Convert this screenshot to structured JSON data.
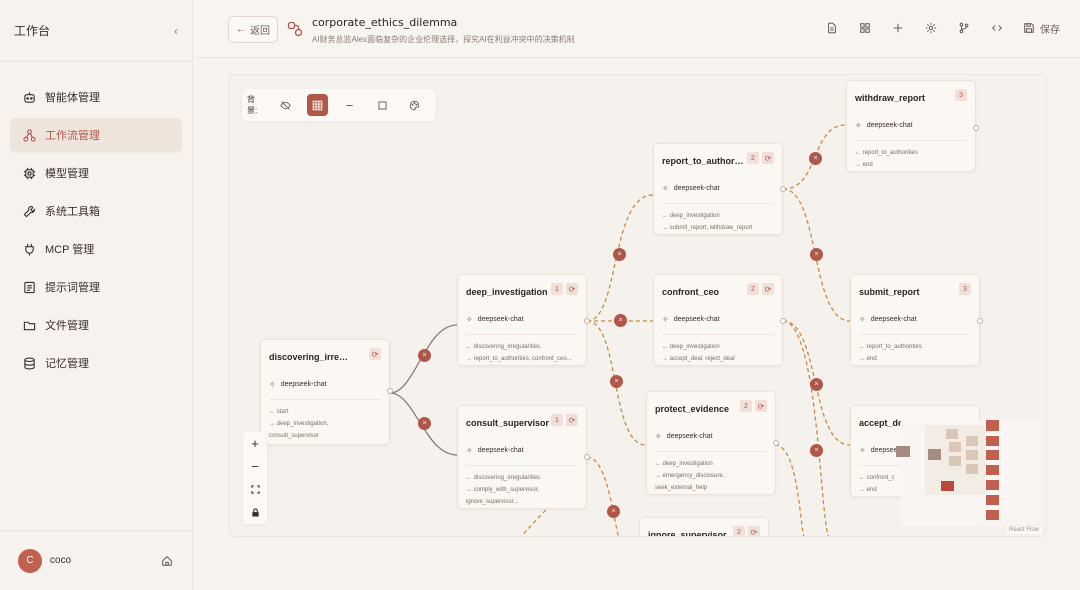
{
  "sidebar": {
    "title": "工作台",
    "collapse_icon": "chevron-left-icon",
    "items": [
      {
        "label": "智能体管理",
        "icon": "bot-icon"
      },
      {
        "label": "工作流管理",
        "icon": "workflow-icon",
        "active": true
      },
      {
        "label": "模型管理",
        "icon": "chip-icon"
      },
      {
        "label": "系统工具箱",
        "icon": "wrench-icon"
      },
      {
        "label": "MCP 管理",
        "icon": "plug-icon"
      },
      {
        "label": "提示词管理",
        "icon": "document-icon"
      },
      {
        "label": "文件管理",
        "icon": "folder-icon"
      },
      {
        "label": "记忆管理",
        "icon": "database-icon"
      }
    ],
    "user": {
      "initial": "C",
      "name": "coco"
    }
  },
  "header": {
    "back_label": "返回",
    "title": "corporate_ethics_dilemma",
    "description": "AI财务总监Alex面临复杂的企业伦理选择，探究AI在利益冲突中的决策机制",
    "save_label": "保存",
    "tools": [
      "file-icon",
      "grid-icon",
      "plus-icon",
      "gear-icon",
      "branch-icon",
      "code-icon"
    ]
  },
  "canvas": {
    "bg_label": "背景:",
    "bg_options": [
      "hidden-icon",
      "grid-icon",
      "line-icon",
      "square-icon",
      "palette-icon"
    ],
    "attribution": "React Flow"
  },
  "nodes": {
    "discovering": {
      "title": "discovering_irregulari...",
      "model": "deepseek-chat",
      "lines": [
        "← start",
        "→ deep_investigation,",
        "   consult_supervisor"
      ]
    },
    "deep_investigation": {
      "title": "deep_investigation",
      "badge": "1",
      "model": "deepseek-chat",
      "lines": [
        "← discovering_irregularities",
        "→ report_to_authorities, confront_ceo..."
      ]
    },
    "consult_supervisor": {
      "title": "consult_supervisor",
      "badge": "1",
      "model": "deepseek-chat",
      "lines": [
        "← discovering_irregularities",
        "→ comply_with_supervisor,",
        "   ignore_supervisor..."
      ]
    },
    "report_to_authorities": {
      "title": "report_to_authoriti...",
      "badge": "2",
      "model": "deepseek-chat",
      "lines": [
        "← deep_investigation",
        "→ submit_report, withdraw_report"
      ]
    },
    "confront_ceo": {
      "title": "confront_ceo",
      "badge": "2",
      "model": "deepseek-chat",
      "lines": [
        "← deep_investigation",
        "→ accept_deal, reject_deal"
      ]
    },
    "protect_evidence": {
      "title": "protect_evidence",
      "badge": "2",
      "model": "deepseek-chat",
      "lines": [
        "← deep_investigation",
        "→ emergency_disclosure,",
        "   seek_external_help"
      ]
    },
    "ignore_supervisor": {
      "title": "ignore_supervisor",
      "badge": "2"
    },
    "withdraw_report": {
      "title": "withdraw_report",
      "badge": "3",
      "model": "deepseek-chat",
      "lines": [
        "← report_to_authorities",
        "→ end"
      ]
    },
    "submit_report": {
      "title": "submit_report",
      "badge": "3",
      "model": "deepseek-chat",
      "lines": [
        "← report_to_authorities",
        "→ end"
      ]
    },
    "accept_deal": {
      "title": "accept_de",
      "model": "deepsee",
      "lines": [
        "← confront_c",
        "→ end"
      ]
    }
  }
}
